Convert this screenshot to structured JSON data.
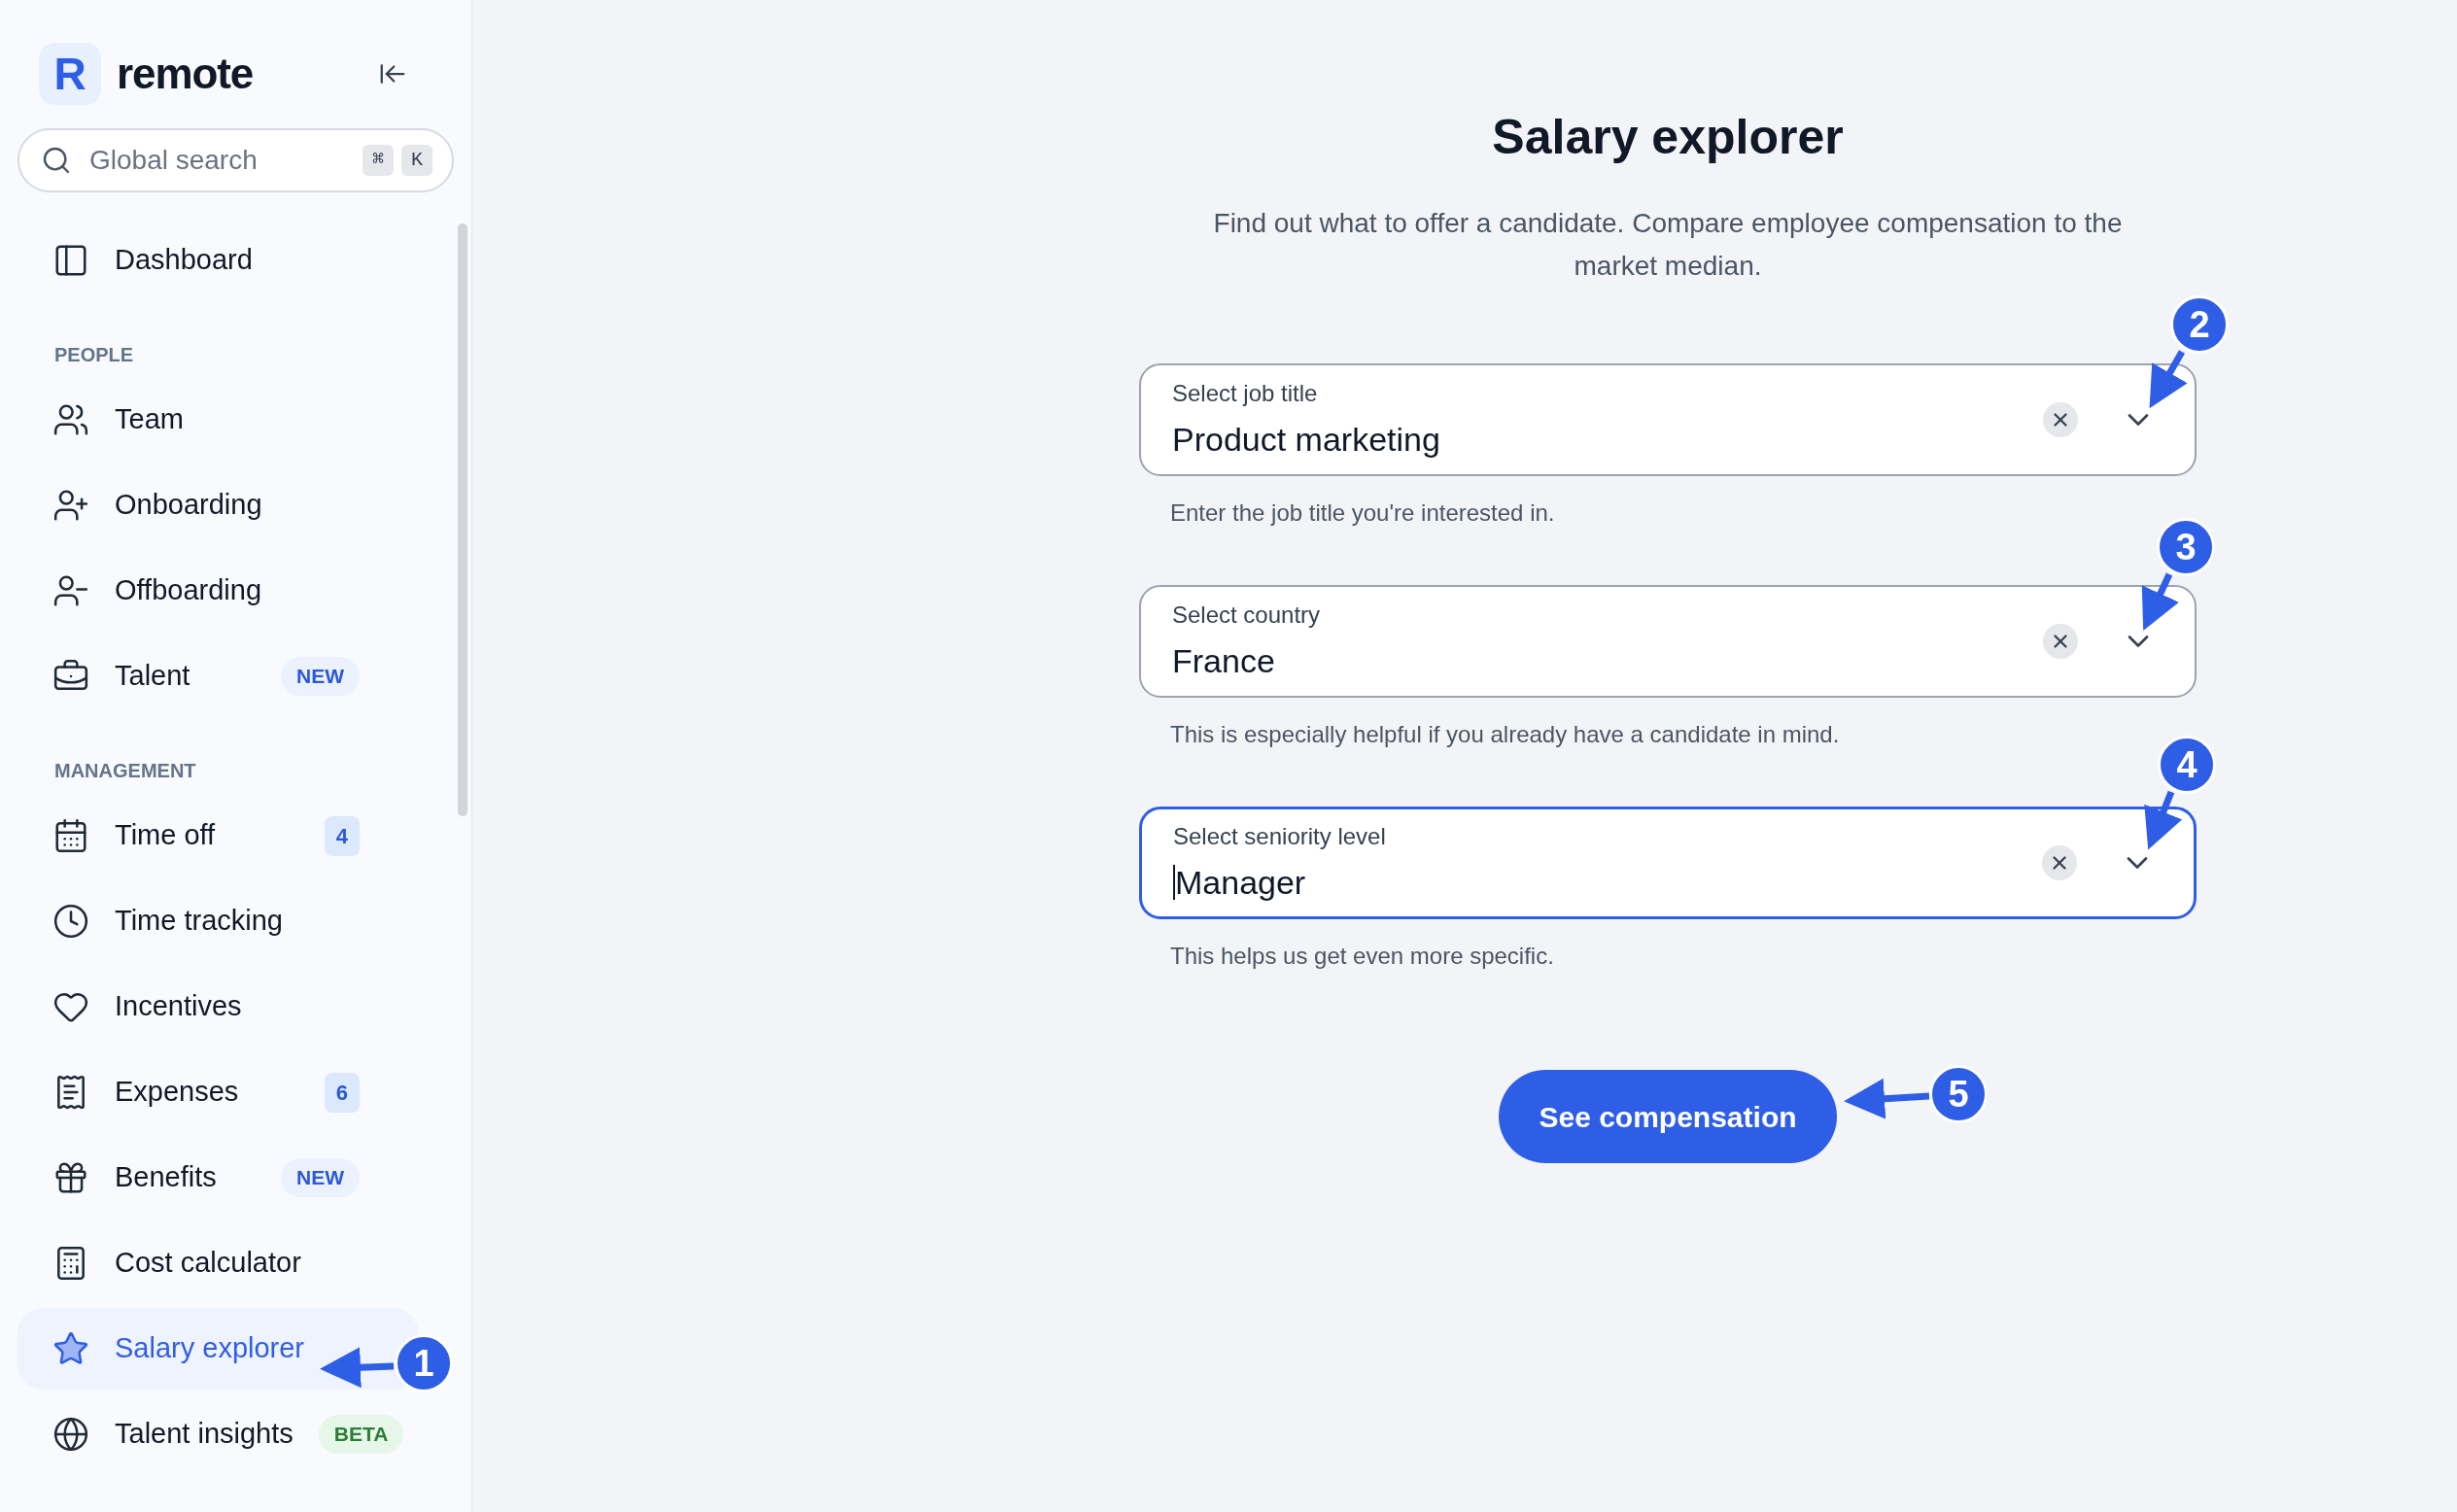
{
  "sidebar": {
    "logo": {
      "mark": "R",
      "name": "remote"
    },
    "search": {
      "placeholder": "Global search",
      "shortcut": [
        "⌘",
        "K"
      ]
    },
    "sections": [
      {
        "items": [
          {
            "label": "Dashboard",
            "selected": false
          }
        ]
      },
      {
        "heading": "PEOPLE",
        "items": [
          {
            "label": "Team",
            "selected": false
          },
          {
            "label": "Onboarding",
            "selected": false
          },
          {
            "label": "Offboarding",
            "selected": false
          },
          {
            "label": "Talent",
            "selected": false,
            "badge": {
              "kind": "new",
              "text": "NEW"
            }
          }
        ]
      },
      {
        "heading": "MANAGEMENT",
        "items": [
          {
            "label": "Time off",
            "selected": false,
            "badge": {
              "kind": "count",
              "text": "4"
            }
          },
          {
            "label": "Time tracking",
            "selected": false
          },
          {
            "label": "Incentives",
            "selected": false
          },
          {
            "label": "Expenses",
            "selected": false,
            "badge": {
              "kind": "count",
              "text": "6"
            }
          },
          {
            "label": "Benefits",
            "selected": false,
            "badge": {
              "kind": "new",
              "text": "NEW"
            }
          },
          {
            "label": "Cost calculator",
            "selected": false
          },
          {
            "label": "Salary explorer",
            "selected": true
          },
          {
            "label": "Talent insights",
            "selected": false,
            "badge": {
              "kind": "beta",
              "text": "BETA"
            }
          }
        ]
      }
    ]
  },
  "main": {
    "title": "Salary explorer",
    "description": "Find out what to offer a candidate. Compare employee compensation to the market median.",
    "fields": [
      {
        "label": "Select job title",
        "value": "Product marketing",
        "focused": false,
        "help": "Enter the job title you're interested in."
      },
      {
        "label": "Select country",
        "value": "France",
        "focused": false,
        "help": "This is especially helpful if you already have a candidate in mind."
      },
      {
        "label": "Select seniority level",
        "value": "Manager",
        "focused": true,
        "help": "This helps us get even more specific."
      }
    ],
    "button": "See compensation"
  },
  "annotations": [
    {
      "number": "1"
    },
    {
      "number": "2"
    },
    {
      "number": "3"
    },
    {
      "number": "4"
    },
    {
      "number": "5"
    }
  ]
}
